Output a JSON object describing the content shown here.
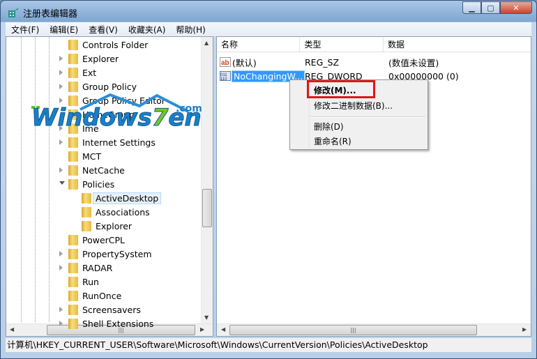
{
  "window": {
    "title": "注册表编辑器",
    "icon": "regedit-icon",
    "controls": {
      "minimize": "minimize-icon",
      "maximize": "maximize-icon",
      "close": "close-icon"
    }
  },
  "menu": [
    {
      "label": "文件(F)"
    },
    {
      "label": "编辑(E)"
    },
    {
      "label": "查看(V)"
    },
    {
      "label": "收藏夹(A)"
    },
    {
      "label": "帮助(H)"
    }
  ],
  "tree": [
    {
      "label": "Controls Folder",
      "expander": false,
      "level": 0
    },
    {
      "label": "Explorer",
      "expander": true,
      "level": 0
    },
    {
      "label": "Ext",
      "expander": true,
      "level": 0
    },
    {
      "label": "Group Policy",
      "expander": true,
      "level": 0
    },
    {
      "label": "Group Policy Editor",
      "expander": true,
      "level": 0
    },
    {
      "label": "HomeGroup",
      "expander": false,
      "level": 0
    },
    {
      "label": "Ime",
      "expander": true,
      "level": 0
    },
    {
      "label": "Internet Settings",
      "expander": true,
      "level": 0
    },
    {
      "label": "MCT",
      "expander": false,
      "level": 0
    },
    {
      "label": "NetCache",
      "expander": true,
      "level": 0
    },
    {
      "label": "Policies",
      "expander": true,
      "expanded": true,
      "level": 0
    },
    {
      "label": "ActiveDesktop",
      "expander": false,
      "level": 1,
      "selected": true
    },
    {
      "label": "Associations",
      "expander": false,
      "level": 1
    },
    {
      "label": "Explorer",
      "expander": false,
      "level": 1
    },
    {
      "label": "PowerCPL",
      "expander": false,
      "level": 0
    },
    {
      "label": "PropertySystem",
      "expander": true,
      "level": 0
    },
    {
      "label": "RADAR",
      "expander": true,
      "level": 0
    },
    {
      "label": "Run",
      "expander": false,
      "level": 0
    },
    {
      "label": "RunOnce",
      "expander": false,
      "level": 0
    },
    {
      "label": "Screensavers",
      "expander": true,
      "level": 0
    },
    {
      "label": "Shell Extensions",
      "expander": true,
      "level": 0
    }
  ],
  "values": {
    "columns": [
      "名称",
      "类型",
      "数据"
    ],
    "rows": [
      {
        "name": "(默认)",
        "type": "REG_SZ",
        "data": "(数值未设置)",
        "icon": "string-value-icon"
      },
      {
        "name": "NoChangingW...",
        "type": "REG_DWORD",
        "data": "0x00000000 (0)",
        "icon": "dword-value-icon",
        "selected": true
      }
    ]
  },
  "context_menu": {
    "items": [
      "修改(M)...",
      "修改二进制数据(B)...",
      "删除(D)",
      "重命名(R)"
    ],
    "highlighted": "修改(M)...",
    "highlight_color": "#e0141a"
  },
  "status": {
    "path": "计算机\\HKEY_CURRENT_USER\\Software\\Microsoft\\Windows\\CurrentVersion\\Policies\\ActiveDesktop"
  },
  "watermark": {
    "text": "Windows7en",
    "suffix": ".com"
  },
  "colors": {
    "selection": "#3399ff",
    "titlebar": "#7ea6d1"
  }
}
